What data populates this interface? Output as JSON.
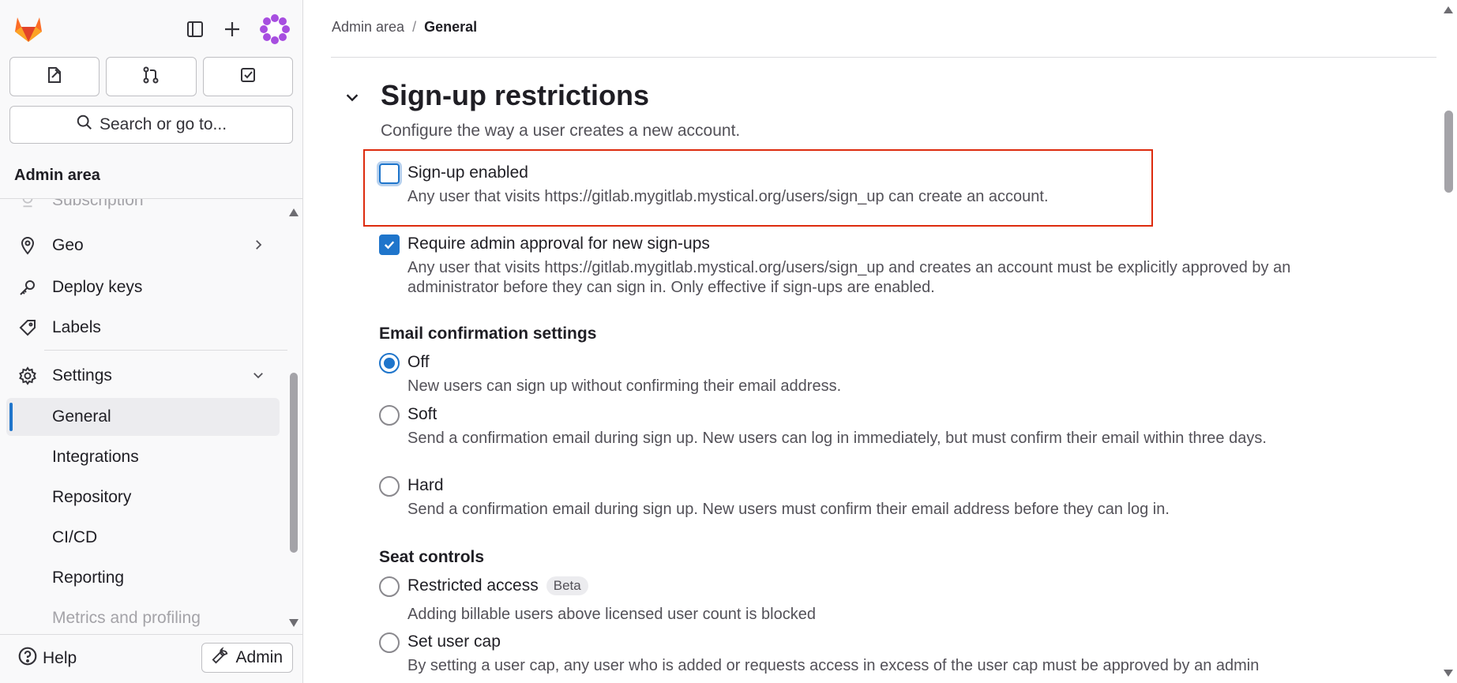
{
  "colors": {
    "accent": "#1f75cb",
    "highlight": "#dd2b0e",
    "logo_orange": "#fc6d26"
  },
  "sidebar": {
    "quick_actions": [
      {
        "icon": "issues-icon"
      },
      {
        "icon": "merge-request-icon"
      },
      {
        "icon": "todo-icon"
      }
    ],
    "search_label": "Search or go to...",
    "area_title": "Admin area",
    "items": {
      "subscription": "Subscription",
      "geo": "Geo",
      "deploy_keys": "Deploy keys",
      "labels": "Labels",
      "settings": "Settings"
    },
    "settings_sub": {
      "general": "General",
      "integrations": "Integrations",
      "repository": "Repository",
      "cicd": "CI/CD",
      "reporting": "Reporting",
      "metrics": "Metrics and profiling"
    },
    "help_label": "Help",
    "admin_label": "Admin"
  },
  "breadcrumb": {
    "parent": "Admin area",
    "separator": "/",
    "current": "General"
  },
  "section": {
    "title": "Sign-up restrictions",
    "description": "Configure the way a user creates a new account."
  },
  "signup_enabled": {
    "label": "Sign-up enabled",
    "help": "Any user that visits https://gitlab.mygitlab.mystical.org/users/sign_up can create an account.",
    "checked": false
  },
  "admin_approval": {
    "label": "Require admin approval for new sign-ups",
    "help": "Any user that visits https://gitlab.mygitlab.mystical.org/users/sign_up and creates an account must be explicitly approved by an administrator before they can sign in. Only effective if sign-ups are enabled.",
    "checked": true
  },
  "email_confirmation": {
    "heading": "Email confirmation settings",
    "off": {
      "label": "Off",
      "help": "New users can sign up without confirming their email address.",
      "selected": true
    },
    "soft": {
      "label": "Soft",
      "help": "Send a confirmation email during sign up. New users can log in immediately, but must confirm their email within three days."
    },
    "hard": {
      "label": "Hard",
      "help": "Send a confirmation email during sign up. New users must confirm their email address before they can log in."
    }
  },
  "seat_controls": {
    "heading": "Seat controls",
    "restricted": {
      "label": "Restricted access",
      "badge": "Beta",
      "help": "Adding billable users above licensed user count is blocked"
    },
    "user_cap": {
      "label": "Set user cap",
      "help": "By setting a user cap, any user who is added or requests access in excess of the user cap must be approved by an admin"
    }
  }
}
